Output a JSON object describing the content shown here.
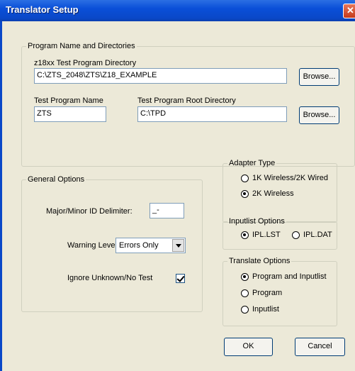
{
  "window": {
    "title": "Translator Setup",
    "close_glyph": "✕"
  },
  "program_group": {
    "legend": "Program Name and Directories",
    "dir_label": "z18xx Test Program Directory",
    "dir_value": "C:\\ZTS_2048\\ZTS\\Z18_EXAMPLE",
    "browse1": "Browse...",
    "name_label": "Test Program Name",
    "name_value": "ZTS",
    "root_label": "Test Program Root Directory",
    "root_value": "C:\\TPD",
    "browse2": "Browse..."
  },
  "general_options": {
    "legend": "General Options",
    "delimiter_label": "Major/Minor ID Delimiter:",
    "delimiter_value": "_-",
    "warning_label": "Warning Level:",
    "warning_value": "Errors Only",
    "ignore_label": "Ignore Unknown/No Test",
    "ignore_checked": true
  },
  "adapter_type": {
    "legend": "Adapter Type",
    "options": [
      "1K Wireless/2K Wired",
      "2K Wireless"
    ],
    "selected": "2K Wireless"
  },
  "inputlist_options": {
    "legend": "Inputlist Options",
    "options": [
      "IPL.LST",
      "IPL.DAT"
    ],
    "selected": "IPL.LST"
  },
  "translate_options": {
    "legend": "Translate Options",
    "options": [
      "Program and Inputlist",
      "Program",
      "Inputlist"
    ],
    "selected": "Program and Inputlist"
  },
  "buttons": {
    "ok": "OK",
    "cancel": "Cancel"
  }
}
